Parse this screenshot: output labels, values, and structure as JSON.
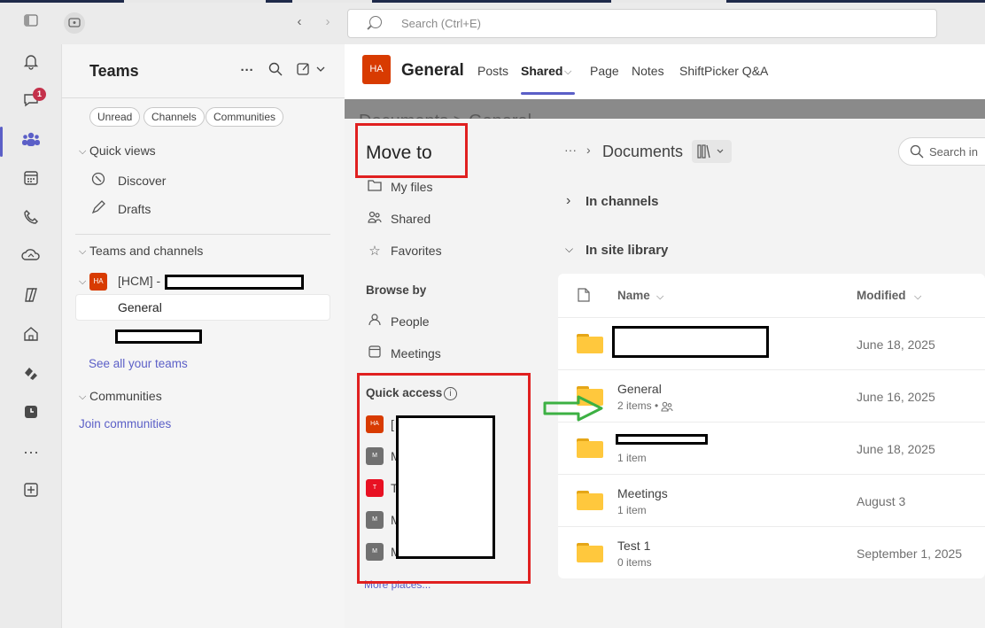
{
  "titlebar": {
    "search_placeholder": "Search (Ctrl+E)"
  },
  "rail": {
    "chat_badge": "1"
  },
  "teams_panel": {
    "title": "Teams",
    "filters": [
      "Unread",
      "Channels",
      "Communities"
    ],
    "quick_views_label": "Quick views",
    "discover": "Discover",
    "drafts": "Drafts",
    "teams_channels_label": "Teams and channels",
    "team_name": "[HCM] -",
    "team_avatar": "HA",
    "channel_general": "General",
    "see_all": "See all your teams",
    "communities_label": "Communities",
    "join": "Join communities"
  },
  "header": {
    "avatar": "HA",
    "title": "General",
    "tabs": [
      "Posts",
      "Shared",
      "Page",
      "Notes",
      "ShiftPicker Q&A"
    ]
  },
  "doc_breadcrumb": "Documents > General",
  "move_to": {
    "title": "Move to",
    "my_files": "My files",
    "shared": "Shared",
    "favorites": "Favorites",
    "browse_by": "Browse by",
    "people": "People",
    "meetings": "Meetings",
    "quick_access": "Quick access",
    "quick_access_items": [
      {
        "avatar": "HA",
        "letter": "[",
        "color": "#d83b01"
      },
      {
        "avatar": "M",
        "letter": "M",
        "color": "#707070"
      },
      {
        "avatar": "T",
        "letter": "T",
        "color": "#e81123"
      },
      {
        "avatar": "M",
        "letter": "M",
        "color": "#707070"
      },
      {
        "avatar": "M",
        "letter": "M",
        "color": "#707070"
      }
    ],
    "more_places": "More places..."
  },
  "library": {
    "breadcrumb_more": "···",
    "breadcrumb": "Documents",
    "search_placeholder": "Search in",
    "in_channels": "In channels",
    "in_site_library": "In site library",
    "col_name": "Name",
    "col_modified": "Modified",
    "rows": [
      {
        "name": "",
        "sub": "",
        "modified": "June 18, 2025"
      },
      {
        "name": "General",
        "sub": "2 items •",
        "modified": "June 16, 2025"
      },
      {
        "name": "",
        "sub": "1 item",
        "modified": "June 18, 2025"
      },
      {
        "name": "Meetings",
        "sub": "1 item",
        "modified": "August 3"
      },
      {
        "name": "Test 1",
        "sub": "0 items",
        "modified": "September 1, 2025"
      }
    ]
  },
  "colors": {
    "accent": "#5b5fc7",
    "annotation_red": "#e02020",
    "annotation_green": "#3cb043"
  }
}
